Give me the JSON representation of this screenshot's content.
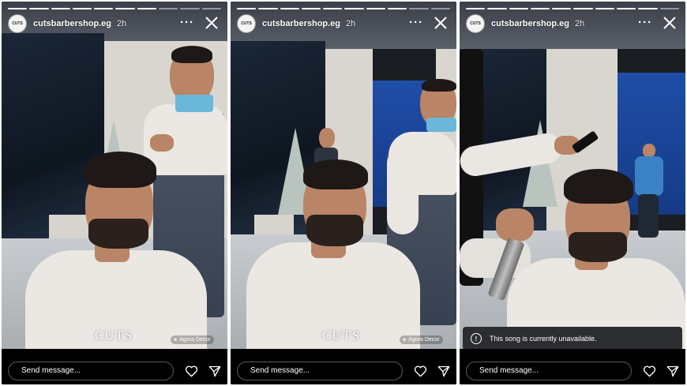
{
  "stories": [
    {
      "username": "cutsbarbershop.eg",
      "time": "2h",
      "avatar_text": "CUTS",
      "brand": "CUTS",
      "credit": "Agora Decor",
      "message_placeholder": "Send message...",
      "icons": {
        "more": "more-horizontal-icon",
        "close": "close-icon",
        "like": "heart-icon",
        "share": "send-icon"
      }
    },
    {
      "username": "cutsbarbershop.eg",
      "time": "2h",
      "avatar_text": "CUTS",
      "brand": "CUTS",
      "credit": "Agora Decor",
      "message_placeholder": "Send message...",
      "icons": {
        "more": "more-horizontal-icon",
        "close": "close-icon",
        "like": "heart-icon",
        "share": "send-icon"
      }
    },
    {
      "username": "cutsbarbershop.eg",
      "time": "2h",
      "avatar_text": "CUTS",
      "toast": "This song is currently unavailable.",
      "message_placeholder": "Send message...",
      "icons": {
        "more": "more-horizontal-icon",
        "close": "close-icon",
        "like": "heart-icon",
        "share": "send-icon",
        "info": "info-icon"
      }
    }
  ],
  "colors": {
    "bar": "#000000",
    "text": "#ffffff",
    "toast": "#2b2d31"
  }
}
